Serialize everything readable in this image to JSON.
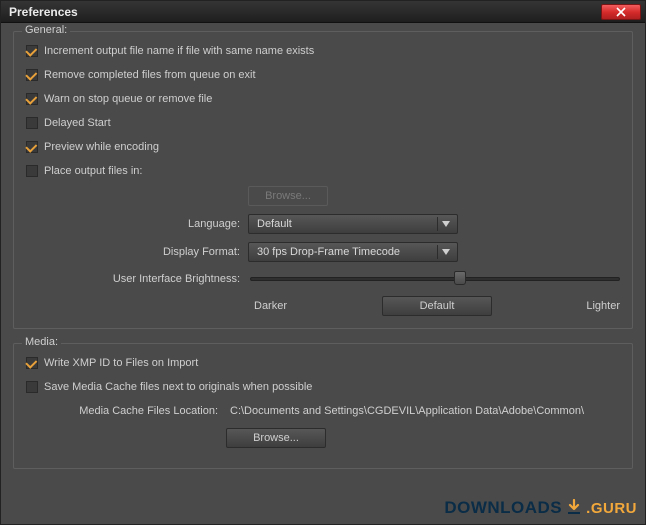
{
  "window": {
    "title": "Preferences"
  },
  "general": {
    "legend": "General:",
    "increment_output": "Increment output file name if file with same name exists",
    "remove_completed": "Remove completed files from queue on exit",
    "warn_stop": "Warn on stop queue or remove file",
    "delayed_start": "Delayed Start",
    "preview_encoding": "Preview while encoding",
    "place_output": "Place output files in:",
    "browse": "Browse...",
    "language_label": "Language:",
    "language_value": "Default",
    "display_format_label": "Display Format:",
    "display_format_value": "30 fps Drop-Frame Timecode",
    "ui_brightness_label": "User Interface Brightness:",
    "darker": "Darker",
    "default_btn": "Default",
    "lighter": "Lighter",
    "checked": {
      "increment_output": true,
      "remove_completed": true,
      "warn_stop": true,
      "delayed_start": false,
      "preview_encoding": true,
      "place_output": false
    }
  },
  "media": {
    "legend": "Media:",
    "write_xmp": "Write XMP ID to Files on Import",
    "save_cache": "Save Media Cache files next to originals when possible",
    "cache_location_label": "Media Cache Files Location:",
    "cache_location_value": "C:\\Documents and Settings\\CGDEVIL\\Application Data\\Adobe\\Common\\",
    "browse": "Browse...",
    "checked": {
      "write_xmp": true,
      "save_cache": false
    }
  },
  "watermark": {
    "text1": "DOWNLOADS",
    "text2": ".GURU"
  }
}
